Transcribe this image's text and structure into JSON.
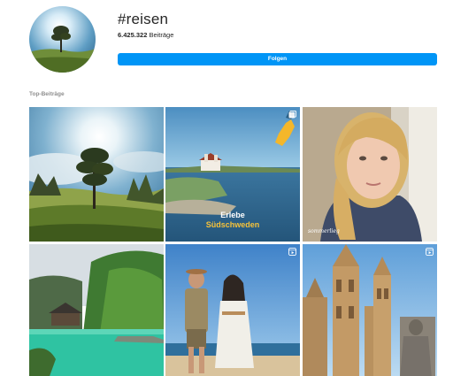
{
  "header": {
    "hashtag": "#reisen",
    "posts_count": "6.425.322",
    "posts_suffix": "Beiträge",
    "follow_label": "Folgen"
  },
  "section": {
    "label": "Top-Beiträge"
  },
  "posts": [
    {
      "caption": ""
    },
    {
      "caption_line1": "Erlebe",
      "caption_line2": "Südschweden"
    },
    {
      "caption": "sommerlieg"
    },
    {
      "caption": ""
    },
    {
      "caption": ""
    },
    {
      "caption": ""
    }
  ],
  "icons": {
    "reel": "reel-icon",
    "carousel": "carousel-icon"
  },
  "colors": {
    "accent": "#0095f6",
    "text": "#262626",
    "muted": "#8e8e8e"
  }
}
